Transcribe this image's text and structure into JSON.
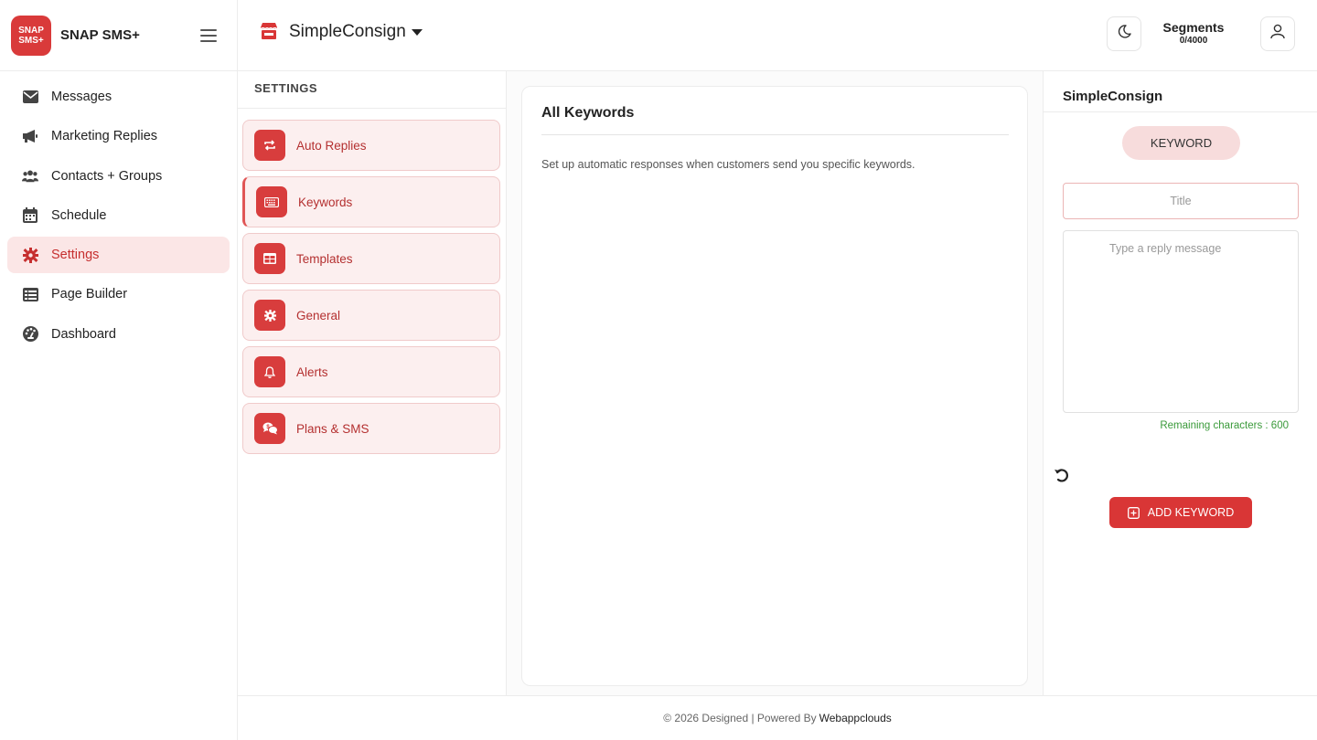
{
  "brand": {
    "logo_line1": "SNAP",
    "logo_line2": "SMS+",
    "name": "SNAP SMS+"
  },
  "sidebar": {
    "items": [
      {
        "label": "Messages",
        "icon": "envelope-icon"
      },
      {
        "label": "Marketing Replies",
        "icon": "megaphone-icon"
      },
      {
        "label": "Contacts + Groups",
        "icon": "users-icon"
      },
      {
        "label": "Schedule",
        "icon": "calendar-icon"
      },
      {
        "label": "Settings",
        "icon": "gear-icon",
        "active": true
      },
      {
        "label": "Page Builder",
        "icon": "table-list-icon"
      },
      {
        "label": "Dashboard",
        "icon": "gauge-icon"
      }
    ]
  },
  "header": {
    "store_name": "SimpleConsign",
    "store_icon": "store-icon",
    "segments_label": "Segments",
    "segments_value": "0/4000"
  },
  "settings": {
    "title": "SETTINGS",
    "items": [
      {
        "label": "Auto Replies",
        "icon": "repeat-icon"
      },
      {
        "label": "Keywords",
        "icon": "keyboard-icon",
        "active": true
      },
      {
        "label": "Templates",
        "icon": "template-grid-icon"
      },
      {
        "label": "General",
        "icon": "gear-icon"
      },
      {
        "label": "Alerts",
        "icon": "bell-icon"
      },
      {
        "label": "Plans & SMS",
        "icon": "chat-bubbles-icon"
      }
    ]
  },
  "keywords_card": {
    "title": "All Keywords",
    "description": "Set up automatic responses when customers send you specific keywords."
  },
  "right_panel": {
    "title": "SimpleConsign",
    "keyword_pill": "KEYWORD",
    "title_placeholder": "Title",
    "reply_placeholder": "Type a reply message",
    "remaining": "Remaining characters : 600",
    "add_button": "ADD KEYWORD"
  },
  "footer": {
    "text": "© 2026 Designed | Powered By",
    "link": "Webappclouds"
  },
  "colors": {
    "accent": "#d93636",
    "accent_light": "#fcefef",
    "success": "#3a9a3a"
  }
}
